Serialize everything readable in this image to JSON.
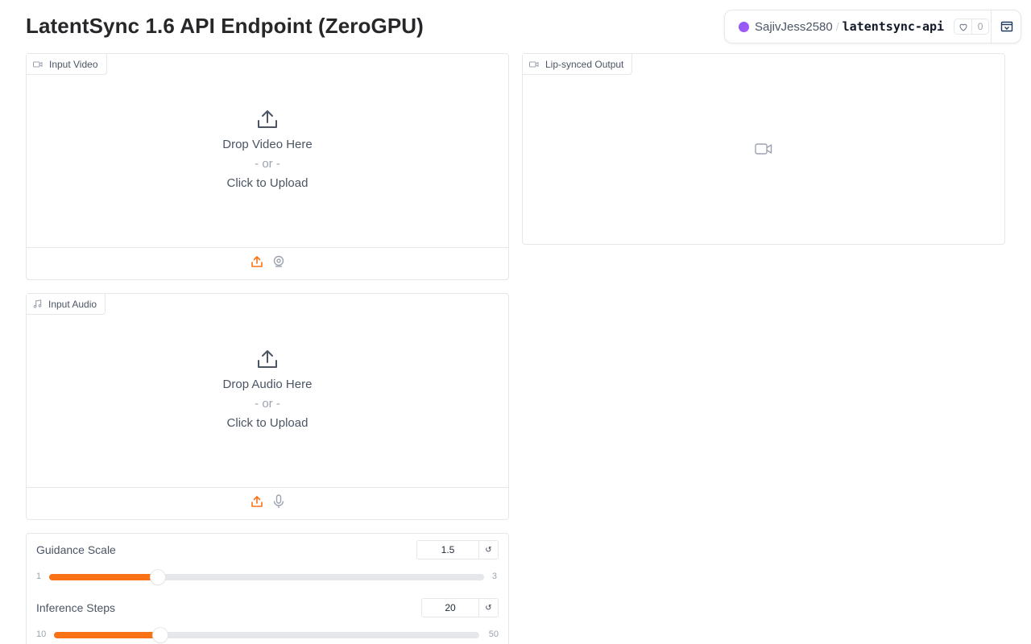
{
  "header": {
    "title": "LatentSync 1.6 API Endpoint (ZeroGPU)"
  },
  "hf_badge": {
    "user": "SajivJess2580",
    "separator": "/",
    "repo": "latentsync-api",
    "likes": "0",
    "dot_color": "#8b5cf6"
  },
  "input_video": {
    "label": "Input Video",
    "drop_text": "Drop Video Here",
    "or_text": "- or -",
    "click_text": "Click to Upload",
    "sources": [
      "upload-icon",
      "webcam-icon"
    ]
  },
  "output_video": {
    "label": "Lip-synced Output",
    "placeholder_icon": "video-icon"
  },
  "input_audio": {
    "label": "Input Audio",
    "drop_text": "Drop Audio Here",
    "or_text": "- or -",
    "click_text": "Click to Upload",
    "sources": [
      "upload-icon",
      "microphone-icon"
    ]
  },
  "sliders": [
    {
      "label": "Guidance Scale",
      "value": "1.5",
      "min": "1",
      "max": "3",
      "fraction": 0.25
    },
    {
      "label": "Inference Steps",
      "value": "20",
      "min": "10",
      "max": "50",
      "fraction": 0.25
    }
  ],
  "colors": {
    "accent": "#f97316",
    "border": "#e5e7eb"
  }
}
